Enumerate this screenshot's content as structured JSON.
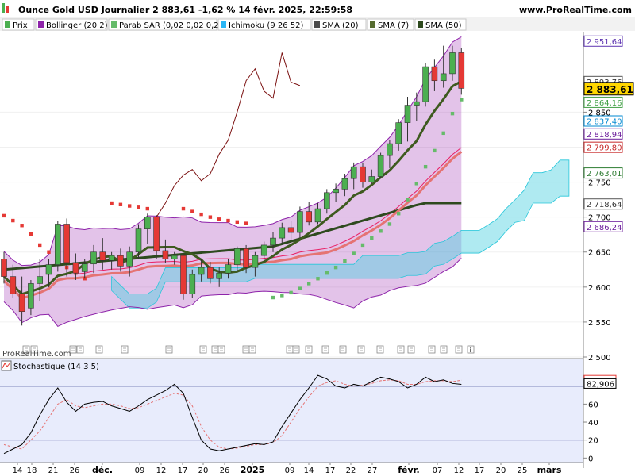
{
  "header": {
    "title": "Ounce Gold USD Journalier 2 883,61 -1,62 % 14 févr. 2025, 22:59:58",
    "site": "www.ProRealTime.com"
  },
  "legend": [
    {
      "label": "Prix",
      "color": "#4caf50"
    },
    {
      "label": "Bollinger (20 2)",
      "color": "#8e24aa"
    },
    {
      "label": "Parab SAR (0,02 0,02 0,2)",
      "color": "#66bb6a"
    },
    {
      "label": "Ichimoku (9 26 52)",
      "color": "#29b6f6"
    },
    {
      "label": "SMA (20)",
      "color": "#4a4a4a"
    },
    {
      "label": "SMA (7)",
      "color": "#556b2f"
    },
    {
      "label": "SMA (50)",
      "color": "#2e4a1e"
    }
  ],
  "watermark": "ProRealTime.com",
  "stoch_title": "Stochastique (14 3 5)",
  "price_axis": {
    "ticks": [
      "2 500",
      "2 550",
      "2 600",
      "2 650",
      "2 700",
      "2 750",
      "2 800",
      "2 850"
    ],
    "tick_values": [
      2500,
      2550,
      2600,
      2650,
      2700,
      2750,
      2800,
      2850
    ],
    "badges": [
      {
        "text": "2 951,64",
        "value": 2951.64,
        "bg": "#ffffff",
        "fg": "#5e35b1",
        "border": "#5e35b1"
      },
      {
        "text": "2 893,76",
        "value": 2893.76,
        "bg": "#ffffff",
        "fg": "#333333",
        "border": "#555555"
      },
      {
        "text": "2 883,61",
        "value": 2883.61,
        "bg": "#ffd600",
        "fg": "#000000",
        "border": "#000000",
        "bold": true
      },
      {
        "text": "2 864,16",
        "value": 2864.16,
        "bg": "#ffffff",
        "fg": "#43a047",
        "border": "#43a047"
      },
      {
        "text": "2 837,40",
        "value": 2837.4,
        "bg": "#ffffff",
        "fg": "#0288d1",
        "border": "#0288d1"
      },
      {
        "text": "2 818,94",
        "value": 2818.94,
        "bg": "#ffffff",
        "fg": "#6a1b9a",
        "border": "#6a1b9a"
      },
      {
        "text": "2 799,80",
        "value": 2799.8,
        "bg": "#ffffff",
        "fg": "#c62828",
        "border": "#c62828"
      },
      {
        "text": "2 763,01",
        "value": 2763.01,
        "bg": "#ffffff",
        "fg": "#2e7d32",
        "border": "#2e7d32"
      },
      {
        "text": "2 718,64",
        "value": 2718.64,
        "bg": "#ffffff",
        "fg": "#333333",
        "border": "#555555"
      },
      {
        "text": "2 686,24",
        "value": 2686.24,
        "bg": "#ffffff",
        "fg": "#6a1b9a",
        "border": "#6a1b9a"
      }
    ]
  },
  "stoch_axis": {
    "ticks": [
      "0",
      "20",
      "40",
      "60"
    ],
    "tick_values": [
      0,
      20,
      40,
      60
    ],
    "badges": [
      {
        "text": "86,642",
        "value": 86.642,
        "fg": "#e53935",
        "bg": "#ffffff",
        "border": "#e53935"
      },
      {
        "text": "82,906",
        "value": 82.906,
        "fg": "#000000",
        "bg": "#ffffff",
        "border": "#000000"
      }
    ]
  },
  "x_axis": {
    "labels": [
      "14",
      "18",
      "21",
      "26",
      "déc.",
      "09",
      "12",
      "17",
      "20",
      "26",
      "2025",
      "09",
      "14",
      "17",
      "22",
      "27",
      "févr.",
      "07",
      "12",
      "17",
      "20",
      "25",
      "mars"
    ],
    "bold": [
      "déc.",
      "2025",
      "févr.",
      "mars"
    ]
  },
  "chart_data": {
    "type": "candlestick",
    "title": "Ounce Gold USD Journalier",
    "price_range": [
      2500,
      2965
    ],
    "candles": [
      {
        "o": 2640,
        "h": 2650,
        "l": 2605,
        "c": 2615
      },
      {
        "o": 2615,
        "h": 2632,
        "l": 2585,
        "c": 2590
      },
      {
        "o": 2590,
        "h": 2615,
        "l": 2545,
        "c": 2565
      },
      {
        "o": 2570,
        "h": 2610,
        "l": 2560,
        "c": 2605
      },
      {
        "o": 2605,
        "h": 2640,
        "l": 2580,
        "c": 2615
      },
      {
        "o": 2618,
        "h": 2640,
        "l": 2600,
        "c": 2632
      },
      {
        "o": 2632,
        "h": 2695,
        "l": 2622,
        "c": 2690
      },
      {
        "o": 2690,
        "h": 2698,
        "l": 2615,
        "c": 2635
      },
      {
        "o": 2635,
        "h": 2648,
        "l": 2610,
        "c": 2620
      },
      {
        "o": 2622,
        "h": 2640,
        "l": 2612,
        "c": 2633
      },
      {
        "o": 2633,
        "h": 2660,
        "l": 2620,
        "c": 2650
      },
      {
        "o": 2650,
        "h": 2670,
        "l": 2625,
        "c": 2638
      },
      {
        "o": 2638,
        "h": 2650,
        "l": 2625,
        "c": 2645
      },
      {
        "o": 2645,
        "h": 2655,
        "l": 2622,
        "c": 2630
      },
      {
        "o": 2630,
        "h": 2658,
        "l": 2615,
        "c": 2650
      },
      {
        "o": 2650,
        "h": 2690,
        "l": 2640,
        "c": 2683
      },
      {
        "o": 2683,
        "h": 2705,
        "l": 2662,
        "c": 2700
      },
      {
        "o": 2700,
        "h": 2703,
        "l": 2640,
        "c": 2652
      },
      {
        "o": 2652,
        "h": 2668,
        "l": 2635,
        "c": 2640
      },
      {
        "o": 2640,
        "h": 2650,
        "l": 2632,
        "c": 2645
      },
      {
        "o": 2645,
        "h": 2648,
        "l": 2582,
        "c": 2590
      },
      {
        "o": 2590,
        "h": 2625,
        "l": 2585,
        "c": 2618
      },
      {
        "o": 2618,
        "h": 2640,
        "l": 2608,
        "c": 2628
      },
      {
        "o": 2628,
        "h": 2636,
        "l": 2605,
        "c": 2612
      },
      {
        "o": 2612,
        "h": 2628,
        "l": 2600,
        "c": 2620
      },
      {
        "o": 2620,
        "h": 2640,
        "l": 2612,
        "c": 2632
      },
      {
        "o": 2632,
        "h": 2658,
        "l": 2622,
        "c": 2655
      },
      {
        "o": 2655,
        "h": 2660,
        "l": 2620,
        "c": 2628
      },
      {
        "o": 2628,
        "h": 2650,
        "l": 2615,
        "c": 2645
      },
      {
        "o": 2645,
        "h": 2665,
        "l": 2636,
        "c": 2660
      },
      {
        "o": 2660,
        "h": 2678,
        "l": 2650,
        "c": 2670
      },
      {
        "o": 2670,
        "h": 2692,
        "l": 2662,
        "c": 2685
      },
      {
        "o": 2685,
        "h": 2695,
        "l": 2668,
        "c": 2678
      },
      {
        "o": 2678,
        "h": 2715,
        "l": 2670,
        "c": 2708
      },
      {
        "o": 2708,
        "h": 2722,
        "l": 2688,
        "c": 2693
      },
      {
        "o": 2693,
        "h": 2720,
        "l": 2690,
        "c": 2712
      },
      {
        "o": 2712,
        "h": 2740,
        "l": 2705,
        "c": 2735
      },
      {
        "o": 2735,
        "h": 2748,
        "l": 2722,
        "c": 2740
      },
      {
        "o": 2740,
        "h": 2762,
        "l": 2730,
        "c": 2755
      },
      {
        "o": 2755,
        "h": 2778,
        "l": 2740,
        "c": 2772
      },
      {
        "o": 2772,
        "h": 2778,
        "l": 2742,
        "c": 2750
      },
      {
        "o": 2750,
        "h": 2768,
        "l": 2748,
        "c": 2758
      },
      {
        "o": 2758,
        "h": 2792,
        "l": 2755,
        "c": 2788
      },
      {
        "o": 2788,
        "h": 2810,
        "l": 2770,
        "c": 2805
      },
      {
        "o": 2805,
        "h": 2840,
        "l": 2795,
        "c": 2835
      },
      {
        "o": 2835,
        "h": 2872,
        "l": 2808,
        "c": 2860
      },
      {
        "o": 2860,
        "h": 2878,
        "l": 2838,
        "c": 2865
      },
      {
        "o": 2865,
        "h": 2920,
        "l": 2858,
        "c": 2915
      },
      {
        "o": 2915,
        "h": 2925,
        "l": 2880,
        "c": 2895
      },
      {
        "o": 2895,
        "h": 2945,
        "l": 2885,
        "c": 2905
      },
      {
        "o": 2905,
        "h": 2945,
        "l": 2895,
        "c": 2935
      },
      {
        "o": 2935,
        "h": 2942,
        "l": 2875,
        "c": 2884
      }
    ],
    "stoch_k": [
      5,
      10,
      15,
      28,
      48,
      65,
      78,
      62,
      52,
      60,
      62,
      63,
      58,
      55,
      52,
      58,
      65,
      70,
      75,
      82,
      72,
      45,
      20,
      10,
      8,
      10,
      12,
      14,
      16,
      15,
      18,
      35,
      50,
      65,
      78,
      92,
      88,
      80,
      78,
      82,
      80,
      85,
      90,
      88,
      85,
      78,
      82,
      90,
      85,
      87,
      83,
      82
    ],
    "stoch_d": [
      15,
      12,
      10,
      20,
      30,
      45,
      60,
      65,
      58,
      56,
      58,
      60,
      60,
      58,
      55,
      56,
      60,
      64,
      68,
      72,
      70,
      58,
      35,
      20,
      12,
      10,
      11,
      13,
      15,
      15,
      17,
      25,
      40,
      55,
      68,
      80,
      84,
      86,
      82,
      80,
      81,
      83,
      86,
      87,
      86,
      82,
      82,
      85,
      86,
      86,
      85,
      86.6
    ],
    "stoch_levels": [
      20,
      80
    ],
    "stoch_range": [
      -5,
      108
    ],
    "sar_points": [
      [
        0,
        2702
      ],
      [
        1,
        2695
      ],
      [
        2,
        2688
      ],
      [
        3,
        2676
      ],
      [
        4,
        2660
      ],
      [
        5,
        2650
      ],
      [
        6,
        2640
      ],
      [
        7,
        2628
      ],
      [
        8,
        2620
      ],
      [
        9,
        2612
      ],
      [
        12,
        2720
      ],
      [
        13,
        2718
      ],
      [
        14,
        2716
      ],
      [
        15,
        2714
      ],
      [
        16,
        2712
      ],
      [
        20,
        2712
      ],
      [
        21,
        2708
      ],
      [
        22,
        2704
      ],
      [
        23,
        2700
      ],
      [
        24,
        2697
      ],
      [
        25,
        2695
      ],
      [
        26,
        2693
      ],
      [
        27,
        2691
      ],
      [
        30,
        2585
      ],
      [
        31,
        2588
      ],
      [
        32,
        2592
      ],
      [
        33,
        2598
      ],
      [
        34,
        2605
      ],
      [
        35,
        2612
      ],
      [
        36,
        2620
      ],
      [
        37,
        2628
      ],
      [
        38,
        2637
      ],
      [
        39,
        2648
      ],
      [
        40,
        2660
      ],
      [
        41,
        2670
      ],
      [
        42,
        2680
      ],
      [
        43,
        2690
      ],
      [
        44,
        2705
      ],
      [
        45,
        2725
      ],
      [
        46,
        2748
      ],
      [
        47,
        2772
      ],
      [
        48,
        2795
      ],
      [
        49,
        2820
      ],
      [
        50,
        2848
      ],
      [
        51,
        2868
      ]
    ],
    "lagging_span": [
      2700,
      2720,
      2745,
      2760,
      2768,
      2752,
      2762,
      2790,
      2810,
      2850,
      2895,
      2912,
      2880,
      2870,
      2935,
      2893,
      2888
    ]
  }
}
